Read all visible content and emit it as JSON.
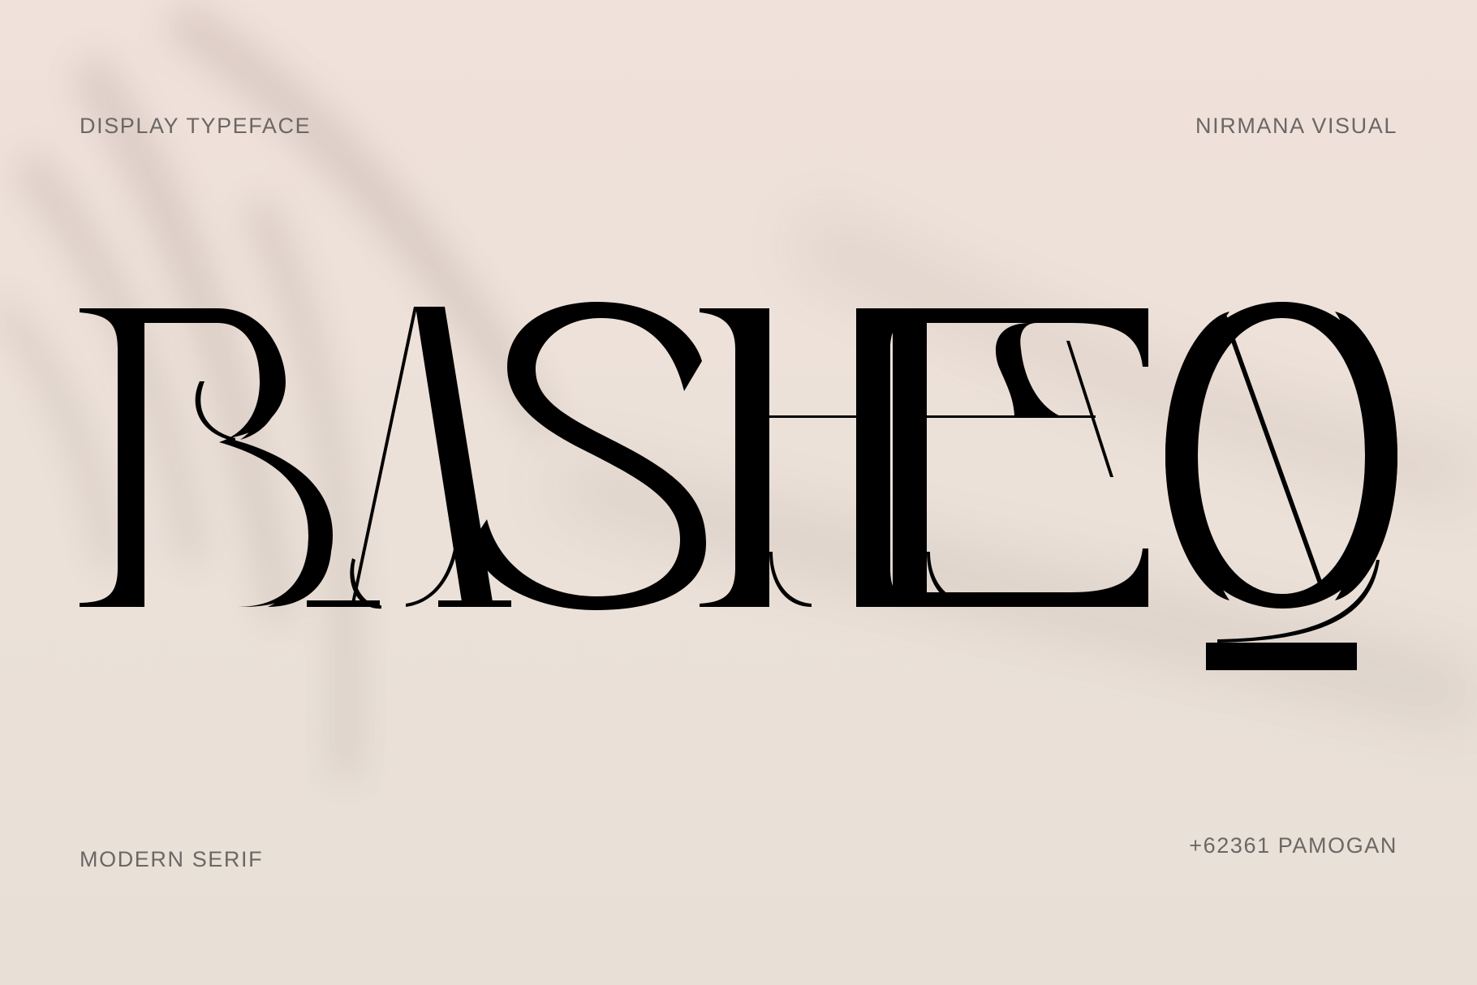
{
  "poster": {
    "top_left": "DISPLAY TYPEFACE",
    "top_right": "NIRMANA VISUAL",
    "bottom_left": "MODERN SERIF",
    "bottom_right": "+62361 PAMOGAN",
    "wordmark": "BASHEQ"
  },
  "colors": {
    "background": "#eee2db",
    "ink": "#000000",
    "caption": "#6b6764"
  }
}
